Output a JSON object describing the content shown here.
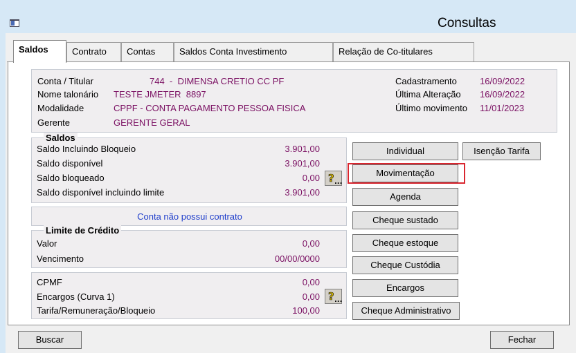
{
  "window": {
    "title": "Consultas",
    "icon": "app-window-icon"
  },
  "tabs": [
    {
      "label": "Saldos",
      "active": true
    },
    {
      "label": "Contrato",
      "active": false
    },
    {
      "label": "Contas",
      "active": false
    },
    {
      "label": "Saldos Conta Investimento",
      "active": false
    },
    {
      "label": "Relação de Co-titulares",
      "active": false
    }
  ],
  "info": {
    "conta_label": "Conta / Titular",
    "conta_value": "744  -  DIMENSA CRETIO CC PF",
    "talonario_label": "Nome talonário",
    "talonario_value": "TESTE JMETER  8897",
    "modalidade_label": "Modalidade",
    "modalidade_value": "CPPF - CONTA PAGAMENTO PESSOA FISICA",
    "gerente_label": "Gerente",
    "gerente_value": "GERENTE GERAL",
    "cadastramento_label": "Cadastramento",
    "cadastramento_value": "16/09/2022",
    "ultima_alteracao_label": "Última Alteração",
    "ultima_alteracao_value": "16/09/2022",
    "ultimo_movimento_label": "Último movimento",
    "ultimo_movimento_value": "11/01/2023"
  },
  "saldos": {
    "title": "Saldos",
    "rows": [
      {
        "label": "Saldo Incluindo Bloqueio",
        "value": "3.901,00"
      },
      {
        "label": "Saldo disponível",
        "value": "3.901,00"
      },
      {
        "label": "Saldo bloqueado",
        "value": "0,00"
      },
      {
        "label": "Saldo disponível incluindo limite",
        "value": "3.901,00"
      }
    ]
  },
  "contrato": {
    "message": "Conta não possui contrato"
  },
  "limite": {
    "title": "Limite de Crédito",
    "rows": [
      {
        "label": "Valor",
        "value": "0,00"
      },
      {
        "label": "Vencimento",
        "value": "00/00/0000"
      }
    ]
  },
  "encargos": {
    "rows": [
      {
        "label": "CPMF",
        "value": "0,00"
      },
      {
        "label": "Encargos (Curva 1)",
        "value": "0,00"
      },
      {
        "label": "Tarifa/Remuneração/Bloqueio",
        "value": "100,00"
      }
    ]
  },
  "help_button": {
    "glyph": "?",
    "dots": "..."
  },
  "actions": {
    "individual": "Individual",
    "isencao": "Isenção Tarifa",
    "movimentacao": "Movimentação",
    "agenda": "Agenda",
    "cheque_sustado": "Cheque sustado",
    "cheque_estoque": "Cheque estoque",
    "cheque_custodia": "Cheque Custódia",
    "encargos": "Encargos",
    "cheque_administrativo": "Cheque Administrativo"
  },
  "footer": {
    "buscar": "Buscar",
    "fechar": "Fechar"
  },
  "colors": {
    "value_text": "#7a0f62",
    "contract_text": "#1f3ecb",
    "highlight": "#d9262f",
    "titlebar": "#d6e8f6"
  }
}
